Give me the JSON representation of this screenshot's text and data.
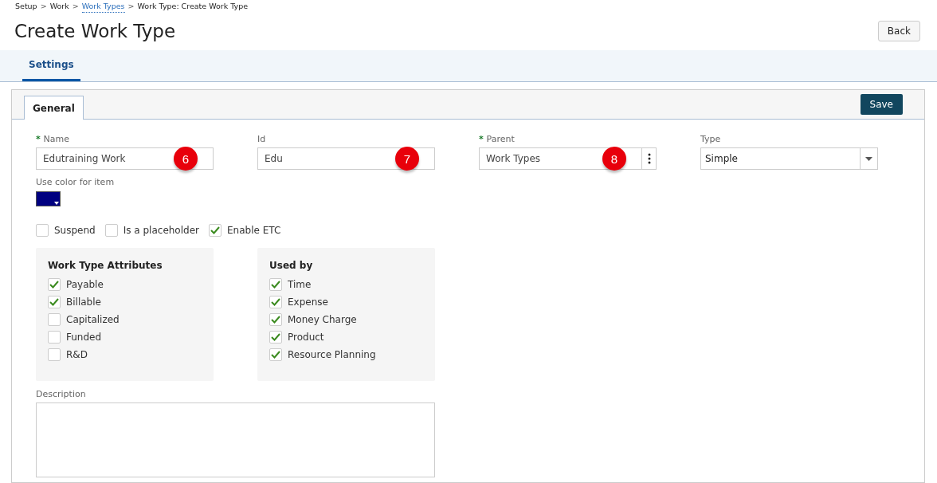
{
  "breadcrumb_separator": ">",
  "breadcrumb": [
    {
      "label": "Setup",
      "link": false
    },
    {
      "label": "Work",
      "link": false
    },
    {
      "label": "Work Types",
      "link": true
    },
    {
      "label": "Work Type: Create Work Type",
      "link": false
    }
  ],
  "title": "Create Work Type",
  "back_button": "Back",
  "page_tabs": [
    {
      "label": "Settings",
      "selected": true
    }
  ],
  "panel_tabs": [
    {
      "label": "General",
      "selected": true
    }
  ],
  "save_button": "Save",
  "fields": [
    {
      "label": "Name",
      "required_mark": "*",
      "value": "Edutraining Work",
      "kind": "text",
      "badge": "6"
    },
    {
      "label": "Id",
      "value": "Edu",
      "kind": "text",
      "badge": "7"
    },
    {
      "label": "Parent",
      "required_mark": "*",
      "value": "Work Types",
      "kind": "picker",
      "badge": "8"
    },
    {
      "label": "Type",
      "value": "Simple",
      "kind": "select"
    }
  ],
  "color_field": {
    "label": "Use color for item",
    "color": "#000080"
  },
  "options": [
    {
      "label": "Suspend",
      "checked": false
    },
    {
      "label": "Is a placeholder",
      "checked": false
    },
    {
      "label": "Enable ETC",
      "checked": true
    }
  ],
  "groups": [
    {
      "title": "Work Type Attributes",
      "items": [
        {
          "label": "Payable",
          "checked": true
        },
        {
          "label": "Billable",
          "checked": true
        },
        {
          "label": "Capitalized",
          "checked": false
        },
        {
          "label": "Funded",
          "checked": false
        },
        {
          "label": "R&D",
          "checked": false
        }
      ]
    },
    {
      "title": "Used by",
      "items": [
        {
          "label": "Time",
          "checked": true
        },
        {
          "label": "Expense",
          "checked": true
        },
        {
          "label": "Money Charge",
          "checked": true
        },
        {
          "label": "Product",
          "checked": true
        },
        {
          "label": "Resource Planning",
          "checked": true
        }
      ]
    }
  ],
  "description": {
    "label": "Description"
  }
}
